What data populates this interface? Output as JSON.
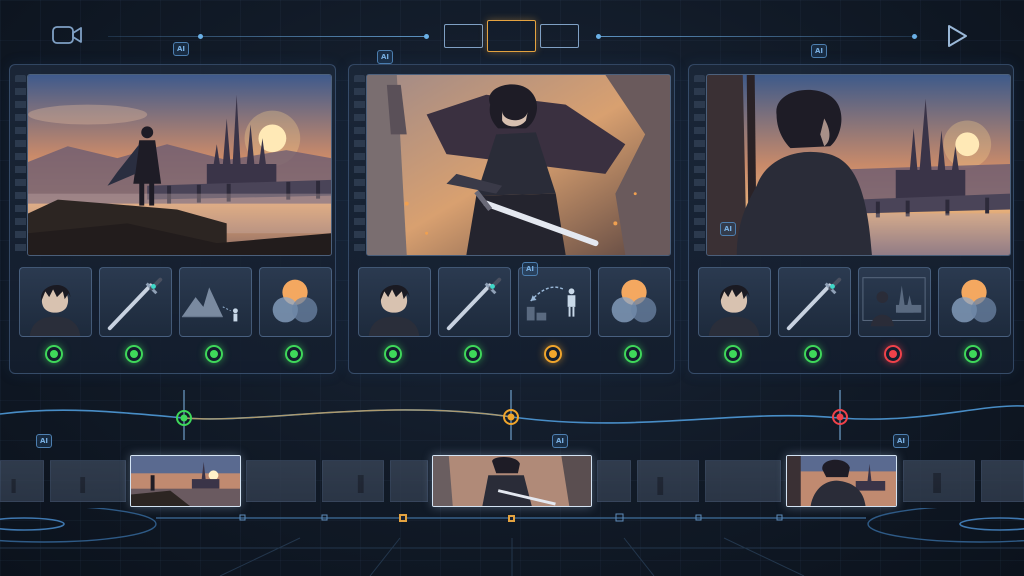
{
  "app": {
    "accent_color": "#e4a340",
    "line_color": "#6ab0e6"
  },
  "toolbar": {
    "camera_icon": "video-camera-icon",
    "play_icon": "play-icon",
    "layout_buttons": [
      "layout-single-left",
      "layout-center-selected",
      "layout-single-right"
    ]
  },
  "ai_badge_label": "AI",
  "shots": [
    {
      "name": "shot-1",
      "scene": "hero-on-cliff-overlooking-castle-sunset",
      "tiles": [
        {
          "name": "character-reference",
          "icon": "character-portrait-icon",
          "status": "approved",
          "status_color": "#3fd85a"
        },
        {
          "name": "prop-reference",
          "icon": "sword-icon",
          "status": "approved",
          "status_color": "#3fd85a"
        },
        {
          "name": "composition-reference",
          "icon": "mountain-figure-icon",
          "status": "approved",
          "status_color": "#3fd85a"
        },
        {
          "name": "color-palette",
          "icon": "color-circles-icon",
          "status": "approved",
          "status_color": "#3fd85a"
        }
      ]
    },
    {
      "name": "shot-2",
      "scene": "hero-sword-attack-closeup",
      "tiles": [
        {
          "name": "character-reference",
          "icon": "character-portrait-icon",
          "status": "approved",
          "status_color": "#3fd85a"
        },
        {
          "name": "prop-reference",
          "icon": "sword-icon",
          "status": "approved",
          "status_color": "#3fd85a"
        },
        {
          "name": "composition-reference",
          "icon": "motion-arrow-figure-icon",
          "status": "warning",
          "status_color": "#f0a52c"
        },
        {
          "name": "color-palette",
          "icon": "color-circles-icon",
          "status": "approved",
          "status_color": "#3fd85a"
        }
      ]
    },
    {
      "name": "shot-3",
      "scene": "hero-over-shoulder-castle-view",
      "tiles": [
        {
          "name": "character-reference",
          "icon": "character-portrait-icon",
          "status": "approved",
          "status_color": "#3fd85a"
        },
        {
          "name": "prop-reference",
          "icon": "sword-icon",
          "status": "approved",
          "status_color": "#3fd85a"
        },
        {
          "name": "composition-reference",
          "icon": "figure-castle-icon",
          "status": "error",
          "status_color": "#f0424a"
        },
        {
          "name": "color-palette",
          "icon": "color-circles-icon",
          "status": "approved",
          "status_color": "#3fd85a"
        }
      ]
    }
  ],
  "timeline": {
    "keyframes": [
      {
        "name": "keyframe-1",
        "status": "approved",
        "color": "#3fd85a"
      },
      {
        "name": "keyframe-2",
        "status": "warning",
        "color": "#f0a52c"
      },
      {
        "name": "keyframe-3",
        "status": "error",
        "color": "#f0424a"
      }
    ]
  }
}
